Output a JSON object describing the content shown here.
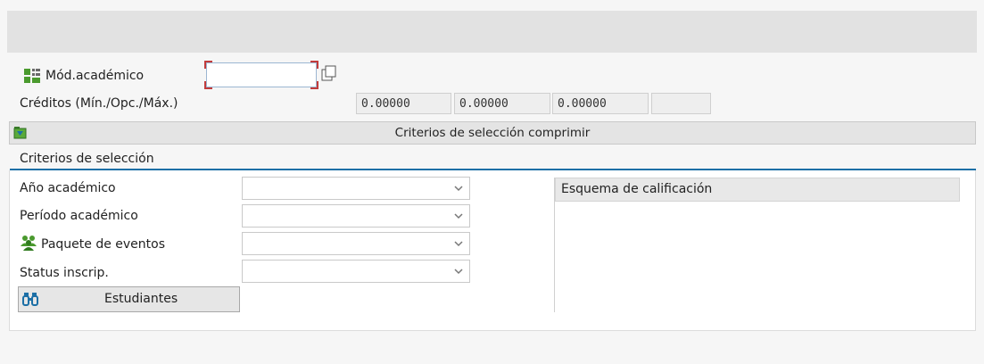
{
  "module": {
    "label": "Mód.académico",
    "value": ""
  },
  "credits": {
    "label": "Créditos (Mín./Opc./Máx.)",
    "min": "0.00000",
    "opt": "0.00000",
    "max": "0.00000",
    "unit": ""
  },
  "collapse_bar": {
    "label": "Criterios de selección comprimir"
  },
  "criteria": {
    "title": "Criterios de selección",
    "fields": [
      {
        "label": "Año académico",
        "value": ""
      },
      {
        "label": "Período académico",
        "value": ""
      },
      {
        "label": "Paquete de eventos",
        "value": ""
      },
      {
        "label": "Status inscrip.",
        "value": ""
      }
    ],
    "students_button": "Estudiantes"
  },
  "grading": {
    "header": "Esquema de calificación"
  },
  "colors": {
    "accent_line": "#1c6fa6",
    "corner_marks": "#c23c3c",
    "icon_green": "#4a9a2e"
  }
}
